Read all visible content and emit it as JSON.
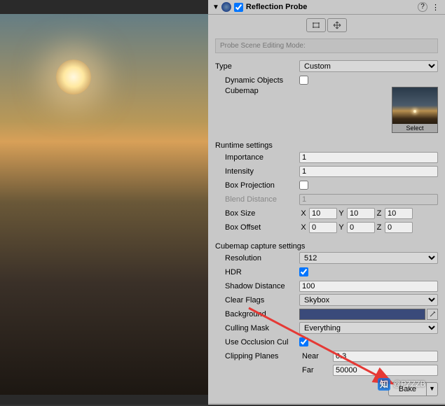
{
  "header": {
    "title": "Reflection Probe",
    "enabled": true
  },
  "editingMode": {
    "label": "Probe Scene Editing Mode:"
  },
  "type": {
    "label": "Type",
    "value": "Custom",
    "dynamicObjects": {
      "label": "Dynamic Objects",
      "value": false
    },
    "cubemap": {
      "label": "Cubemap",
      "selectLabel": "Select"
    }
  },
  "runtime": {
    "section": "Runtime settings",
    "importance": {
      "label": "Importance",
      "value": "1"
    },
    "intensity": {
      "label": "Intensity",
      "value": "1"
    },
    "boxProjection": {
      "label": "Box Projection",
      "value": false
    },
    "blendDistance": {
      "label": "Blend Distance",
      "value": "1"
    },
    "boxSize": {
      "label": "Box Size",
      "x": "10",
      "y": "10",
      "z": "10"
    },
    "boxOffset": {
      "label": "Box Offset",
      "x": "0",
      "y": "0",
      "z": "0"
    }
  },
  "capture": {
    "section": "Cubemap capture settings",
    "resolution": {
      "label": "Resolution",
      "value": "512"
    },
    "hdr": {
      "label": "HDR",
      "value": true
    },
    "shadowDistance": {
      "label": "Shadow Distance",
      "value": "100"
    },
    "clearFlags": {
      "label": "Clear Flags",
      "value": "Skybox"
    },
    "background": {
      "label": "Background"
    },
    "cullingMask": {
      "label": "Culling Mask",
      "value": "Everything"
    },
    "useOcclusion": {
      "label": "Use Occlusion Cul",
      "value": true
    },
    "clipping": {
      "label": "Clipping Planes",
      "nearLabel": "Near",
      "near": "0.3",
      "farLabel": "Far",
      "far": "50000"
    }
  },
  "bake": {
    "label": "Bake"
  },
  "vec": {
    "x": "X",
    "y": "Y",
    "z": "Z"
  },
  "watermark": {
    "text": "@PZZZB"
  }
}
